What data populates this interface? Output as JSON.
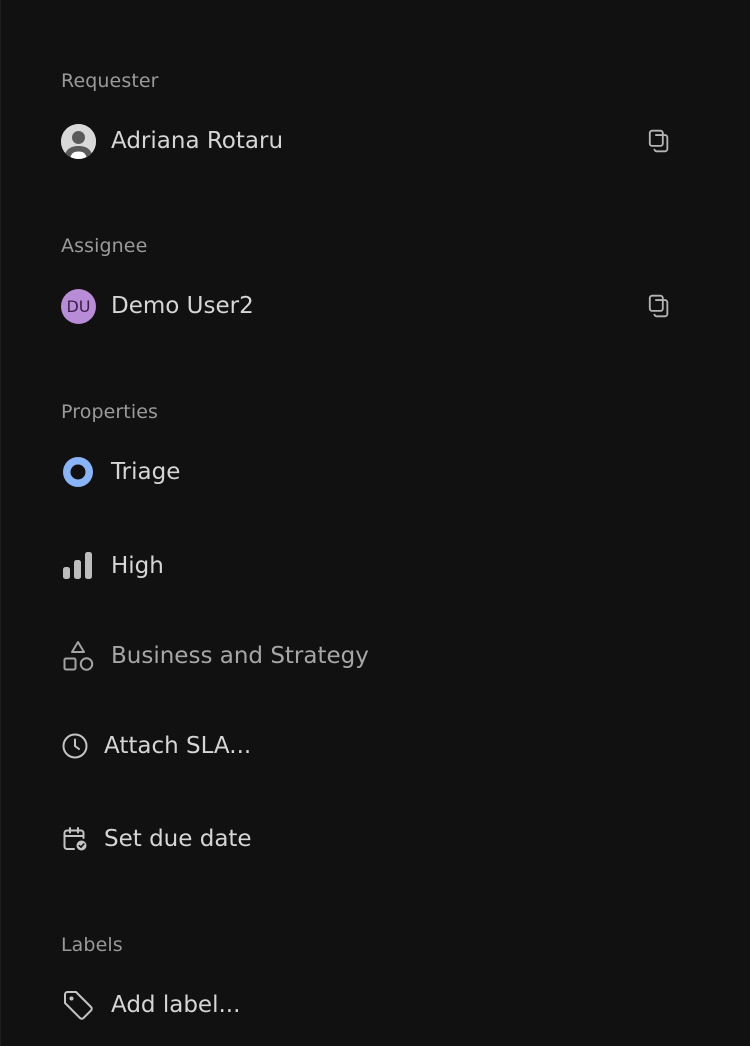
{
  "sections": {
    "requester_label": "Requester",
    "assignee_label": "Assignee",
    "properties_label": "Properties",
    "labels_label": "Labels"
  },
  "requester": {
    "name": "Adriana Rotaru",
    "avatar_icon": "user-silhouette-icon",
    "action_icon": "copy-icon"
  },
  "assignee": {
    "name": "Demo User2",
    "initials": "DU",
    "avatar_color": "#b98cd8",
    "action_icon": "copy-icon"
  },
  "properties": {
    "status": {
      "label": "Triage",
      "icon": "triage-status-icon",
      "color": "#8ab4f8"
    },
    "priority": {
      "label": "High",
      "icon": "priority-high-icon"
    },
    "category": {
      "label": "Business and Strategy",
      "icon": "shapes-icon"
    },
    "sla": {
      "label": "Attach SLA...",
      "icon": "clock-icon"
    },
    "due_date": {
      "label": "Set due date",
      "icon": "calendar-check-icon"
    }
  },
  "labels": {
    "add_label": "Add label...",
    "icon": "tag-icon"
  }
}
